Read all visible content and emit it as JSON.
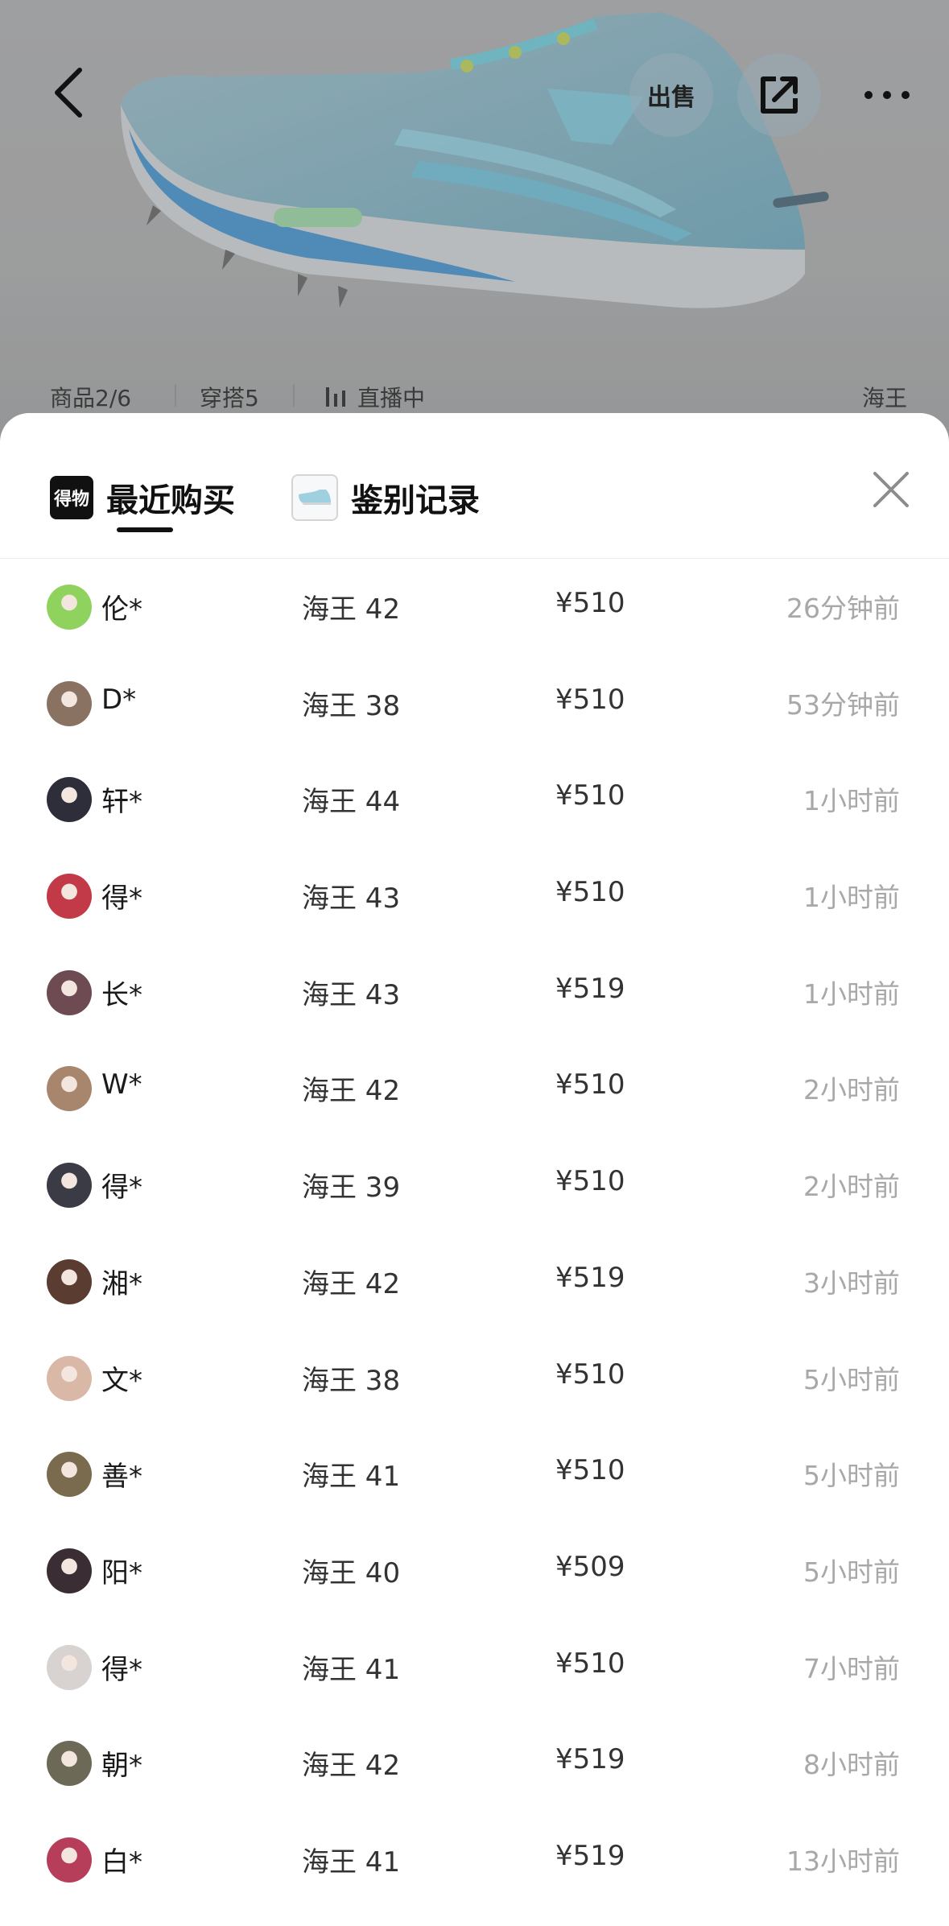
{
  "header": {
    "sell_label": "出售",
    "info": {
      "product_index": "商品2/6",
      "outfits": "穿搭5",
      "live": "直播中",
      "variant": "海王"
    }
  },
  "tabs": [
    {
      "label": "最近购买",
      "icon": "dewu-logo-icon",
      "logo_text": "得物",
      "active": true
    },
    {
      "label": "鉴别记录",
      "icon": "shoe-thumbnail-icon",
      "active": false
    }
  ],
  "purchases": [
    {
      "user": "伦*",
      "size": "海王 42",
      "price": "¥510",
      "time": "26分钟前",
      "avatar_color": "#8fd35e"
    },
    {
      "user": "D*",
      "size": "海王 38",
      "price": "¥510",
      "time": "53分钟前",
      "avatar_color": "#8a7262"
    },
    {
      "user": "轩*",
      "size": "海王 44",
      "price": "¥510",
      "time": "1小时前",
      "avatar_color": "#2e2e3a"
    },
    {
      "user": "得*",
      "size": "海王 43",
      "price": "¥510",
      "time": "1小时前",
      "avatar_color": "#c23a48"
    },
    {
      "user": "长*",
      "size": "海王 43",
      "price": "¥519",
      "time": "1小时前",
      "avatar_color": "#6e4a52"
    },
    {
      "user": "W*",
      "size": "海王 42",
      "price": "¥510",
      "time": "2小时前",
      "avatar_color": "#a8866e"
    },
    {
      "user": "得*",
      "size": "海王 39",
      "price": "¥510",
      "time": "2小时前",
      "avatar_color": "#3b3b45"
    },
    {
      "user": "湘*",
      "size": "海王 42",
      "price": "¥519",
      "time": "3小时前",
      "avatar_color": "#5a3c30"
    },
    {
      "user": "文*",
      "size": "海王 38",
      "price": "¥510",
      "time": "5小时前",
      "avatar_color": "#d9b8a8"
    },
    {
      "user": "善*",
      "size": "海王 41",
      "price": "¥510",
      "time": "5小时前",
      "avatar_color": "#7a6a4e"
    },
    {
      "user": "阳*",
      "size": "海王 40",
      "price": "¥509",
      "time": "5小时前",
      "avatar_color": "#3a2e34"
    },
    {
      "user": "得*",
      "size": "海王 41",
      "price": "¥510",
      "time": "7小时前",
      "avatar_color": "#d8d2d0"
    },
    {
      "user": "朝*",
      "size": "海王 42",
      "price": "¥519",
      "time": "8小时前",
      "avatar_color": "#6c6a56"
    },
    {
      "user": "白*",
      "size": "海王 41",
      "price": "¥519",
      "time": "13小时前",
      "avatar_color": "#b63e5a"
    }
  ]
}
